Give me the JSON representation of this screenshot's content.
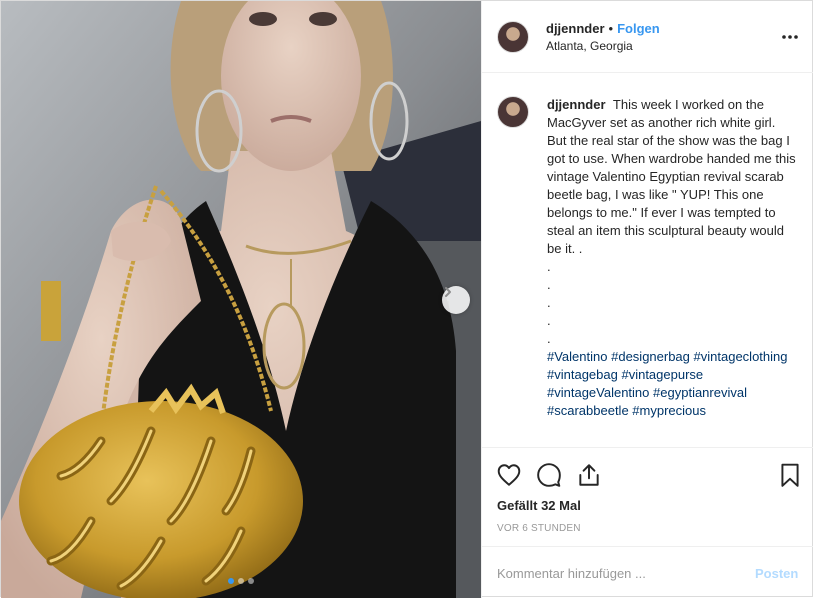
{
  "header": {
    "username": "djjennder",
    "separator": "•",
    "follow_label": "Folgen",
    "location": "Atlanta, Georgia"
  },
  "caption": {
    "username": "djjennder",
    "text": "This week I worked on the MacGyver set as another rich white girl. But the real star of the show was the bag I got to use. When wardrobe handed me this vintage Valentino Egyptian revival scarab beetle bag, I was like \" YUP! This one belongs to me.\" If ever I was tempted to steal an item this sculptural beauty would be it. .\n.\n.\n.\n.\n.",
    "hashtags": [
      "#Valentino",
      "#designerbag",
      "#vintageclothing",
      "#vintagebag",
      "#vintagepurse",
      "#vintageValentino",
      "#egyptianrevival",
      "#scarabbeetle",
      "#myprecious"
    ]
  },
  "actions": {
    "icons": [
      "heart-icon",
      "comment-icon",
      "share-icon",
      "bookmark-icon"
    ],
    "likes": "Gefällt 32 Mal",
    "time": "VOR 6 STUNDEN"
  },
  "comment_box": {
    "placeholder": "Kommentar hinzufügen ...",
    "post_label": "Posten"
  },
  "carousel": {
    "dots": 3,
    "active_index": 0
  },
  "colors": {
    "link": "#3897f0",
    "hashtag": "#003569",
    "post_disabled": "#b3dbff",
    "border": "#efefef"
  }
}
